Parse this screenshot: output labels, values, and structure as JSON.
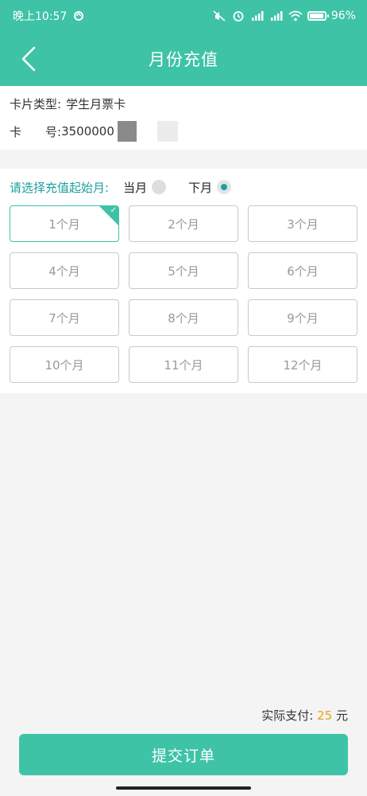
{
  "status_bar": {
    "time": "晚上10:57",
    "battery": "96%"
  },
  "header": {
    "title": "月份充值"
  },
  "card": {
    "type_label": "卡片类型:",
    "type_value": "学生月票卡",
    "number_label": "卡　　号:",
    "number_value": "3500000"
  },
  "selection": {
    "prompt": "请选择充值起始月:",
    "options": [
      {
        "label": "当月",
        "selected": false
      },
      {
        "label": "下月",
        "selected": true
      }
    ]
  },
  "months": [
    {
      "label": "1个月",
      "selected": true
    },
    {
      "label": "2个月",
      "selected": false
    },
    {
      "label": "3个月",
      "selected": false
    },
    {
      "label": "4个月",
      "selected": false
    },
    {
      "label": "5个月",
      "selected": false
    },
    {
      "label": "6个月",
      "selected": false
    },
    {
      "label": "7个月",
      "selected": false
    },
    {
      "label": "8个月",
      "selected": false
    },
    {
      "label": "9个月",
      "selected": false
    },
    {
      "label": "10个月",
      "selected": false
    },
    {
      "label": "11个月",
      "selected": false
    },
    {
      "label": "12个月",
      "selected": false
    }
  ],
  "payment": {
    "label": "实际支付:",
    "amount": "25",
    "unit": "元"
  },
  "submit_label": "提交订单",
  "colors": {
    "primary": "#3fc3a6",
    "accent_text": "#1e9f9f",
    "amount": "#e2a41a"
  }
}
